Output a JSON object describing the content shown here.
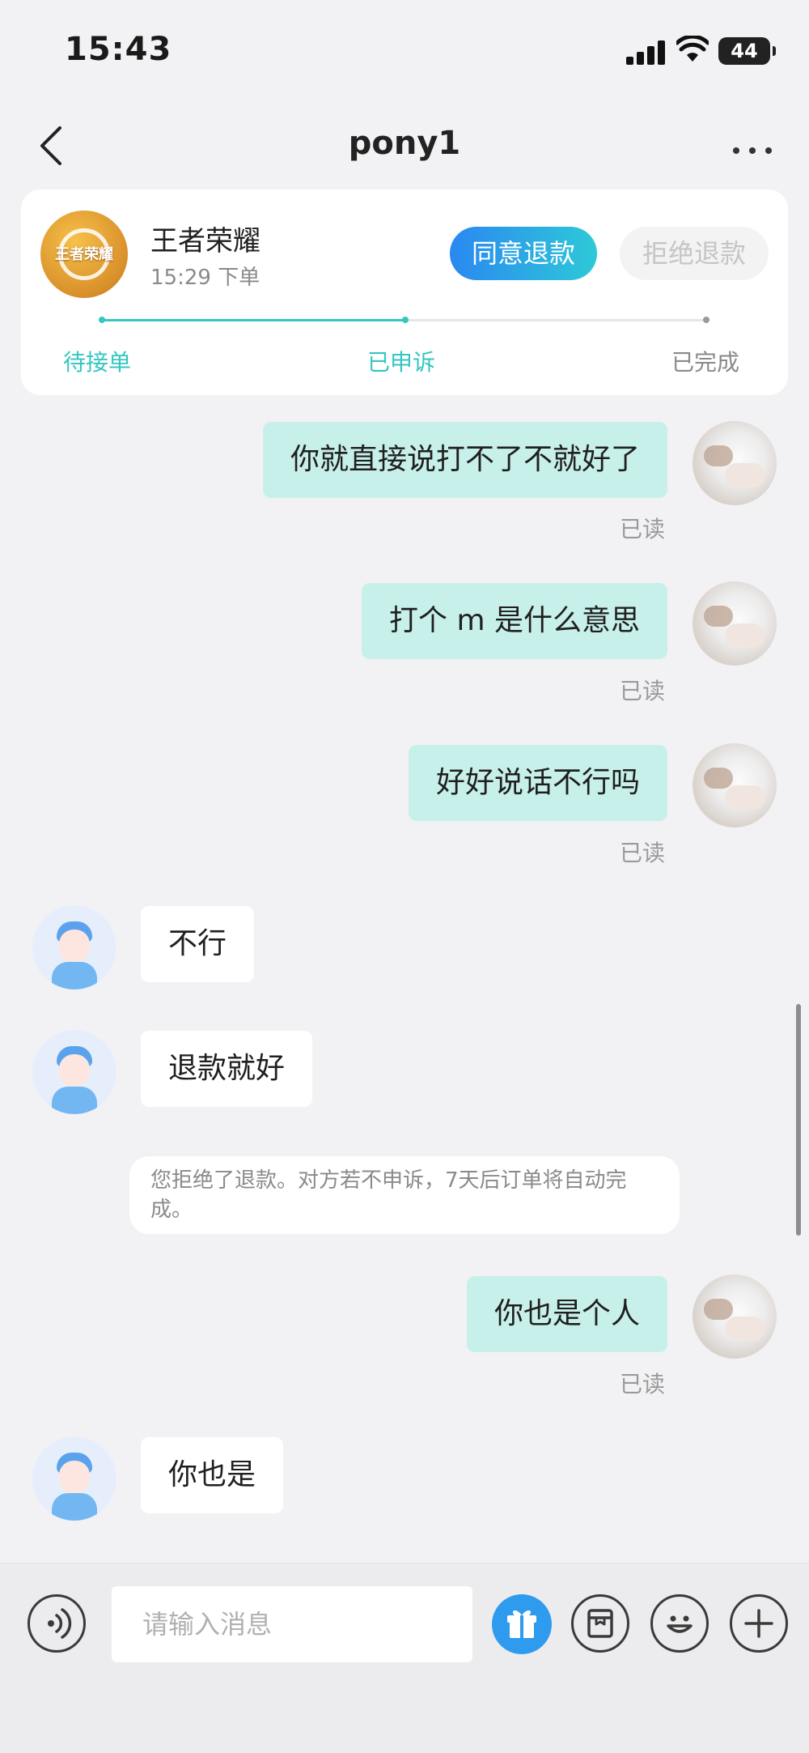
{
  "status_bar": {
    "time": "15:43",
    "battery": "44"
  },
  "nav": {
    "title": "pony1"
  },
  "order": {
    "game_logo_text": "王者荣耀",
    "game_name": "王者荣耀",
    "order_time": "15:29 下单",
    "agree_refund": "同意退款",
    "reject_refund": "拒绝退款",
    "steps": [
      "待接单",
      "已申诉",
      "已完成"
    ],
    "current_step_index": 1,
    "colors": {
      "accent": "#35c6c1",
      "inactive": "#9a9a9a"
    }
  },
  "chat": {
    "read_label": "已读",
    "messages": [
      {
        "from": "me",
        "text": "你就直接说打不了不就好了",
        "read": true
      },
      {
        "from": "me",
        "text": "打个 m 是什么意思",
        "read": true
      },
      {
        "from": "me",
        "text": "好好说话不行吗",
        "read": true
      },
      {
        "from": "other",
        "text": "不行"
      },
      {
        "from": "other",
        "text": "退款就好"
      },
      {
        "from": "system",
        "text": "您拒绝了退款。对方若不申诉，7天后订单将自动完成。"
      },
      {
        "from": "me",
        "text": "你也是个人",
        "read": true
      },
      {
        "from": "other",
        "text": "你也是"
      }
    ]
  },
  "input": {
    "placeholder": "请输入消息"
  },
  "toolbar": {
    "icons": [
      "voice-icon",
      "gift-icon",
      "order-icon",
      "emoji-icon",
      "plus-icon"
    ]
  }
}
